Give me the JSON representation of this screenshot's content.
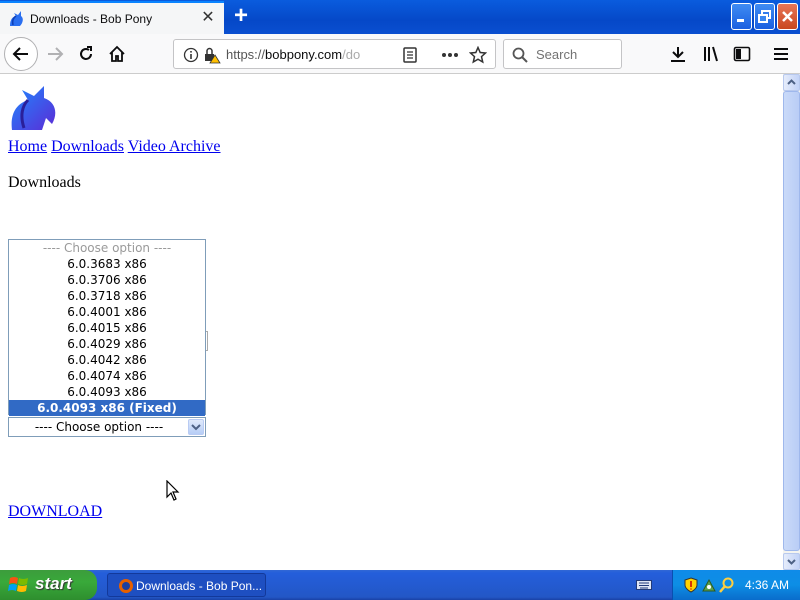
{
  "browser": {
    "tab_title": "Downloads - Bob Pony",
    "url_prefix": "https://",
    "url_host": "bobpony.com",
    "url_path": "/do",
    "search_placeholder": "Search"
  },
  "page": {
    "nav_links": [
      "Home",
      "Downloads",
      "Video Archive"
    ],
    "heading": "Downloads",
    "dropdown_options": [
      {
        "label": "---- Choose option ----",
        "disabled": true
      },
      {
        "label": "6.0.3683 x86"
      },
      {
        "label": "6.0.3706 x86"
      },
      {
        "label": "6.0.3718 x86"
      },
      {
        "label": "6.0.4001 x86"
      },
      {
        "label": "6.0.4015 x86"
      },
      {
        "label": "6.0.4029 x86"
      },
      {
        "label": "6.0.4042 x86"
      },
      {
        "label": "6.0.4074 x86"
      },
      {
        "label": "6.0.4093 x86"
      },
      {
        "label": "6.0.4093 x86 (Fixed)",
        "selected": true
      }
    ],
    "select_value": "---- Choose option ----",
    "download_label": "DOWNLOAD"
  },
  "taskbar": {
    "start_label": "start",
    "task_label": "Downloads - Bob Pon...",
    "clock": "4:36 AM"
  },
  "colors": {
    "link": "#0000ee",
    "selection": "#316ac5",
    "tab_accent": "#0a84ff"
  }
}
